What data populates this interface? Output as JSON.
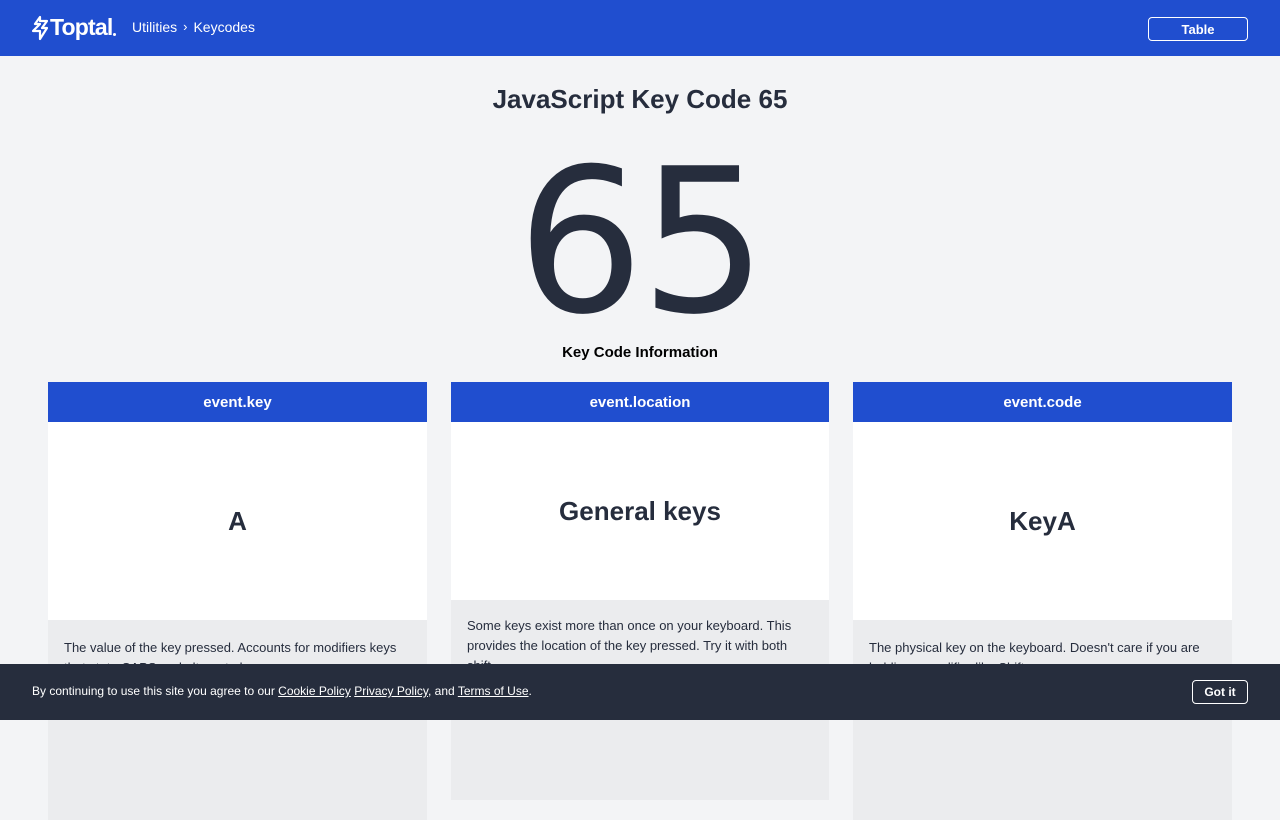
{
  "header": {
    "logo_text": "Toptal",
    "logo_icon": "toptal-logo-icon",
    "breadcrumb": {
      "parent": "Utilities",
      "separator_icon": "chevron-right-icon",
      "current": "Keycodes"
    },
    "table_button": "Table"
  },
  "main": {
    "title": "JavaScript Key Code 65",
    "key_code": "65",
    "info_label": "Key Code Information",
    "cards": [
      {
        "header": "event.key",
        "value": "A",
        "description": "The value of the key pressed. Accounts for modifiers keys that state CAPS and alternate keys."
      },
      {
        "header": "event.location",
        "value": "General keys",
        "description": "Some keys exist more than once on your keyboard. This provides the location of the key pressed. Try it with both shift."
      },
      {
        "header": "event.code",
        "value": "KeyA",
        "description": "The physical key on the keyboard. Doesn't care if you are holding a modifier like Shift."
      }
    ]
  },
  "cookie_bar": {
    "text_prefix": "By continuing to use this site you agree to our",
    "cookie_policy": "Cookie Policy",
    "privacy_policy": "Privacy Policy",
    "and_text": ", and",
    "terms": "Terms of Use",
    "suffix": ".",
    "button": "Got it"
  },
  "colors": {
    "brand_blue": "#204ecf",
    "dark": "#262d3d",
    "page_bg": "#f3f4f6",
    "desc_bg": "#ebecee"
  }
}
